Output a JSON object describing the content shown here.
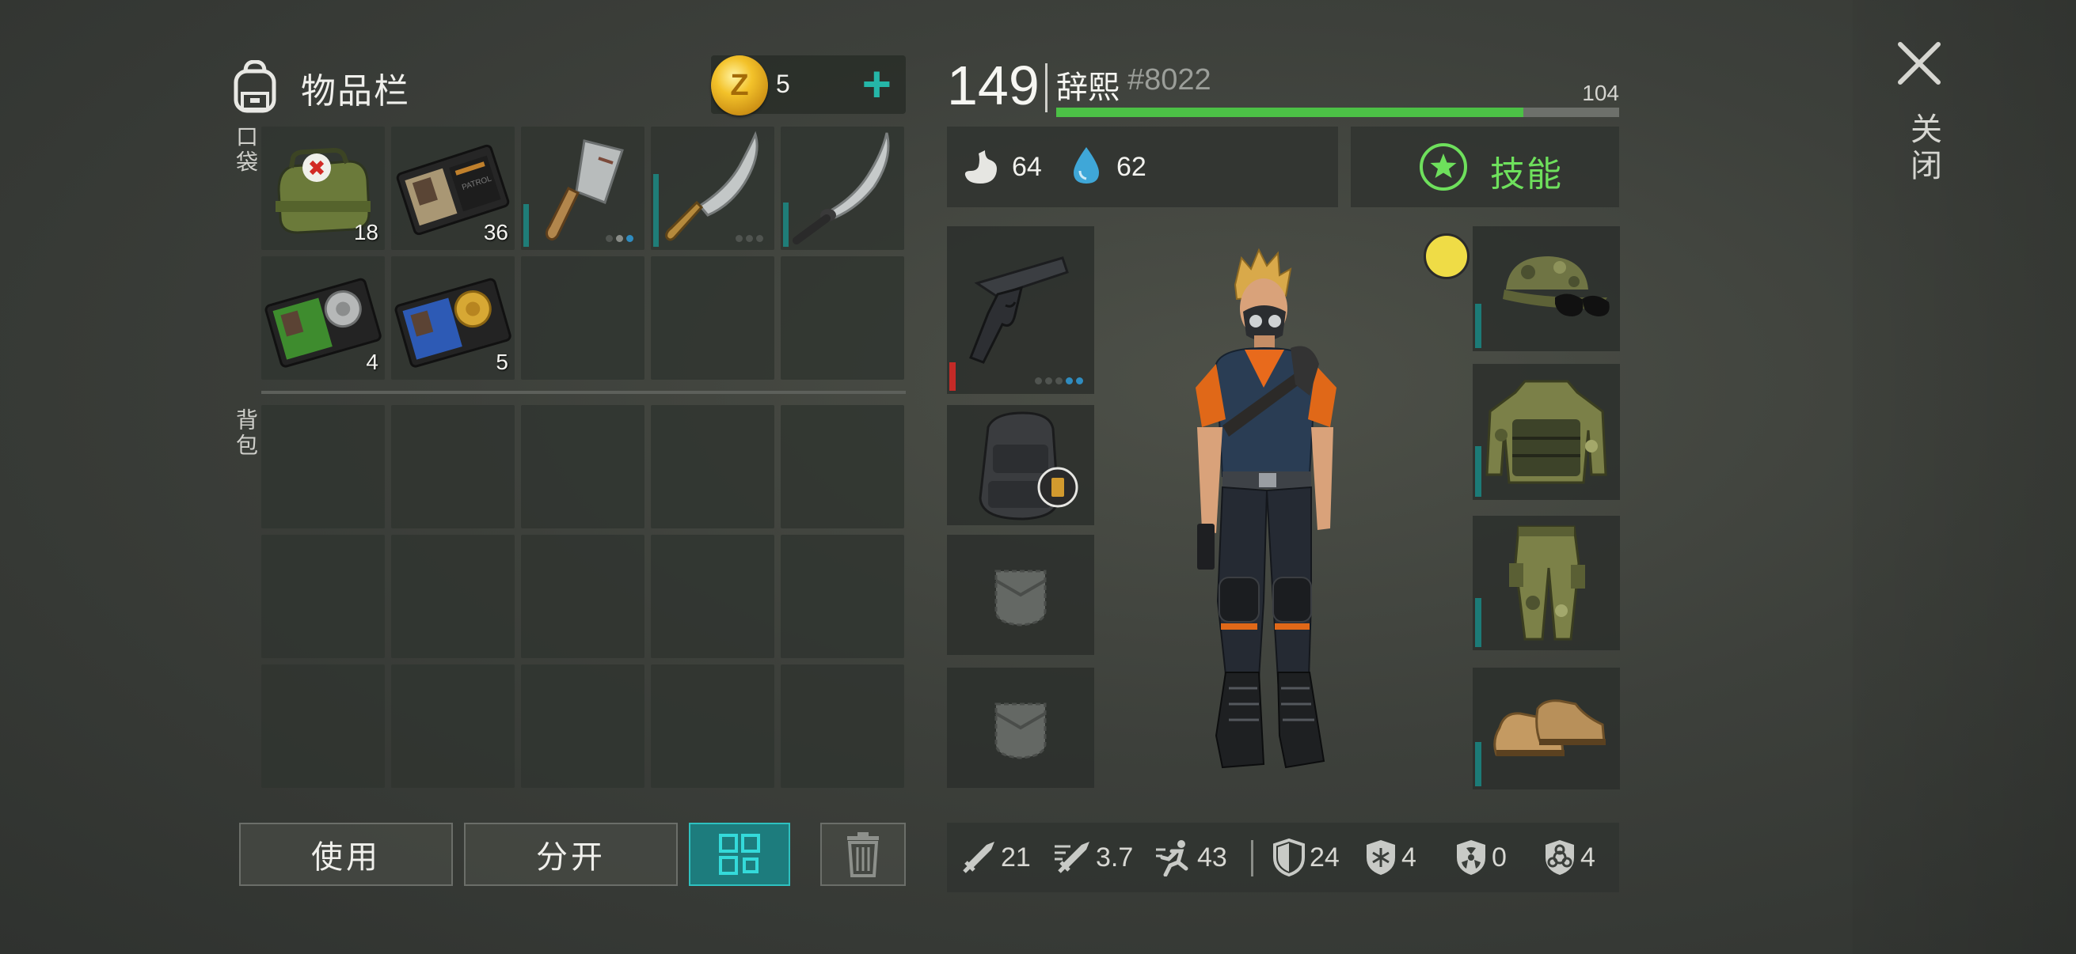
{
  "inventory": {
    "title": "物品栏",
    "pocket_label": "口袋",
    "backpack_label": "背包",
    "coin_count": "5",
    "pocket_items": [
      {
        "name": "medkit",
        "count": "18"
      },
      {
        "name": "patrol-wallet",
        "count": "36"
      },
      {
        "name": "cleaver",
        "count": ""
      },
      {
        "name": "machete",
        "count": ""
      },
      {
        "name": "katana",
        "count": ""
      },
      {
        "name": "police-id-green",
        "count": "4"
      },
      {
        "name": "police-id-blue",
        "count": "5"
      }
    ]
  },
  "actions": {
    "use": "使用",
    "split": "分开"
  },
  "player": {
    "level": "149",
    "name": "辞熙",
    "tag": "#8022",
    "xp_value": "104",
    "xp_fraction": 0.83,
    "food": "64",
    "water": "62",
    "skills_label": "技能"
  },
  "stats": {
    "damage": "21",
    "attack_speed": "3.7",
    "move_speed": "43",
    "armor": "24",
    "cold_resist": "4",
    "radiation": "0",
    "toxic": "4"
  },
  "close_label": "关闭",
  "colors": {
    "accent_teal": "#25b6a8",
    "xp_green": "#4cc146",
    "skill_green": "#6ee05c",
    "coin_gold": "#f3c22a",
    "durability_red": "#c42a27"
  }
}
